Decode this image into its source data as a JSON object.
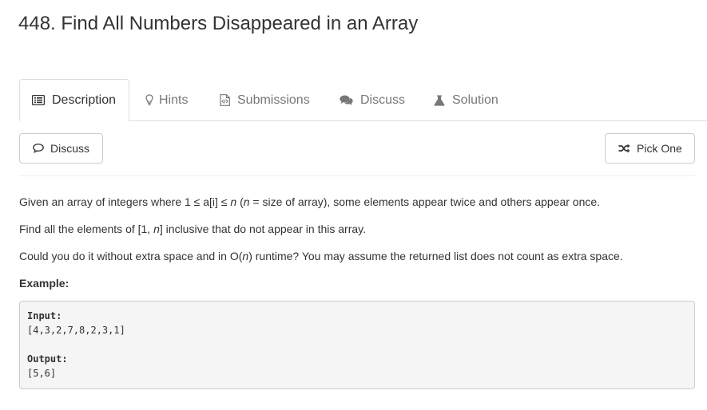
{
  "problem": {
    "title": "448. Find All Numbers Disappeared in an Array"
  },
  "tabs": [
    {
      "label": "Description",
      "icon": "list-icon",
      "active": true
    },
    {
      "label": "Hints",
      "icon": "lightbulb-icon",
      "active": false
    },
    {
      "label": "Submissions",
      "icon": "code-file-icon",
      "active": false
    },
    {
      "label": "Discuss",
      "icon": "comments-icon",
      "active": false
    },
    {
      "label": "Solution",
      "icon": "flask-icon",
      "active": false
    }
  ],
  "toolbar": {
    "discuss_label": "Discuss",
    "pick_one_label": "Pick One"
  },
  "description": {
    "p1": {
      "a": "Given an array of integers where 1 ≤ a[i] ≤ ",
      "n1": "n",
      "b": " (",
      "n2": "n",
      "c": " = size of array), some elements appear twice and others appear once."
    },
    "p2": {
      "a": "Find all the elements of [1, ",
      "n": "n",
      "b": "] inclusive that do not appear in this array."
    },
    "p3": {
      "a": "Could you do it without extra space and in O(",
      "n": "n",
      "b": ") runtime? You may assume the returned list does not count as extra space."
    },
    "example_label": "Example:",
    "example": {
      "input_label": "Input:",
      "input_value": "[4,3,2,7,8,2,3,1]",
      "output_label": "Output:",
      "output_value": "[5,6]"
    }
  },
  "colors": {
    "text": "#333333",
    "muted": "#777777",
    "border": "#dddddd",
    "code_bg": "#f5f5f5"
  }
}
